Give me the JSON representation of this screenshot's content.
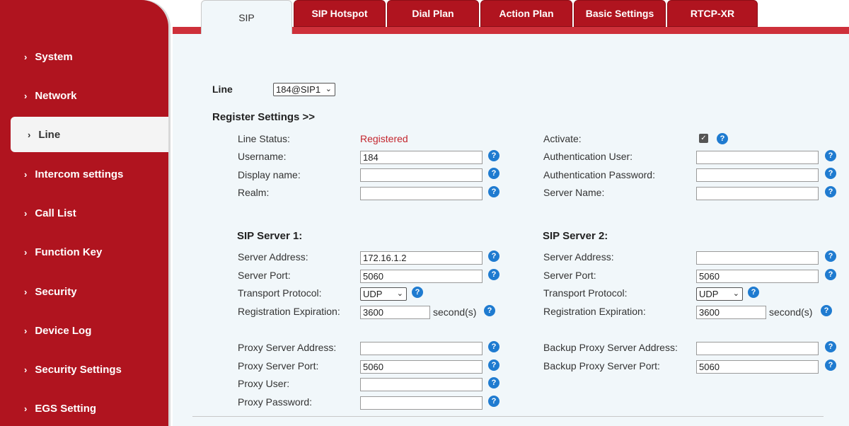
{
  "sidebar": {
    "items": [
      {
        "label": "System"
      },
      {
        "label": "Network"
      },
      {
        "label": "Line"
      },
      {
        "label": "Intercom settings"
      },
      {
        "label": "Call List"
      },
      {
        "label": "Function Key"
      },
      {
        "label": "Security"
      },
      {
        "label": "Device Log"
      },
      {
        "label": "Security Settings"
      },
      {
        "label": "EGS Setting"
      }
    ],
    "active": "Line"
  },
  "tabs": [
    {
      "label": "SIP"
    },
    {
      "label": "SIP Hotspot"
    },
    {
      "label": "Dial Plan"
    },
    {
      "label": "Action Plan"
    },
    {
      "label": "Basic Settings"
    },
    {
      "label": "RTCP-XR"
    }
  ],
  "active_tab": "SIP",
  "line": {
    "label": "Line",
    "selected": "184@SIP1"
  },
  "register": {
    "heading": "Register Settings >>",
    "line_status_label": "Line Status:",
    "line_status_value": "Registered",
    "username_label": "Username:",
    "username_value": "184",
    "display_name_label": "Display name:",
    "display_name_value": "",
    "realm_label": "Realm:",
    "realm_value": "",
    "activate_label": "Activate:",
    "activate_checked": true,
    "auth_user_label": "Authentication User:",
    "auth_user_value": "",
    "auth_password_label": "Authentication Password:",
    "auth_password_value": "",
    "server_name_label": "Server Name:",
    "server_name_value": ""
  },
  "sip_server_1": {
    "heading": "SIP Server 1:",
    "address_label": "Server Address:",
    "address_value": "172.16.1.2",
    "port_label": "Server Port:",
    "port_value": "5060",
    "transport_label": "Transport Protocol:",
    "transport_value": "UDP",
    "expiration_label": "Registration Expiration:",
    "expiration_value": "3600",
    "unit": "second(s)"
  },
  "sip_server_2": {
    "heading": "SIP Server 2:",
    "address_label": "Server Address:",
    "address_value": "",
    "port_label": "Server Port:",
    "port_value": "5060",
    "transport_label": "Transport Protocol:",
    "transport_value": "UDP",
    "expiration_label": "Registration Expiration:",
    "expiration_value": "3600",
    "unit": "second(s)"
  },
  "proxy": {
    "address_label": "Proxy Server Address:",
    "address_value": "",
    "port_label": "Proxy Server Port:",
    "port_value": "5060",
    "user_label": "Proxy User:",
    "user_value": "",
    "password_label": "Proxy Password:",
    "password_value": "",
    "backup_address_label": "Backup Proxy Server Address:",
    "backup_address_value": "",
    "backup_port_label": "Backup Proxy Server Port:",
    "backup_port_value": "5060"
  },
  "icons": {
    "help": "help-icon",
    "chevron": "chevron-right-icon",
    "dropdown": "chevron-down-icon",
    "checkbox": "checkbox-checked-icon"
  },
  "colors": {
    "brand_red": "#b0141f",
    "help_blue": "#1f7bd0",
    "status_red": "#c4262e"
  }
}
